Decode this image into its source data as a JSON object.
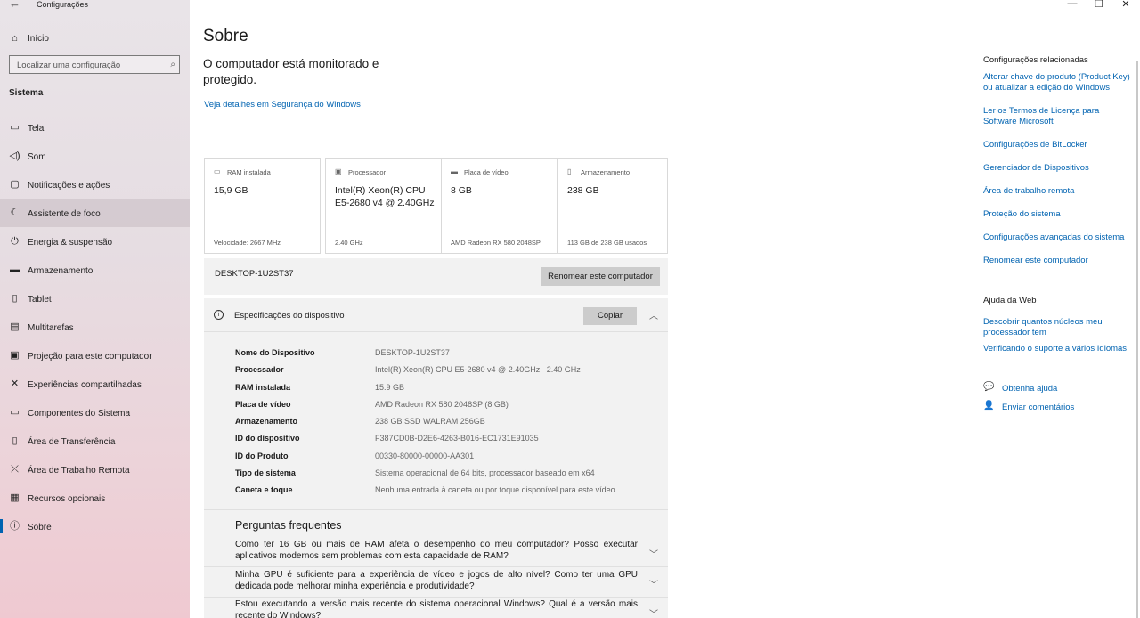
{
  "window": {
    "title": "Configurações",
    "minimize_icon": "—",
    "restore_icon": "❐",
    "close_icon": "✕"
  },
  "sidebar": {
    "home_label": "Início",
    "search_placeholder": "Localizar uma configuração",
    "section": "Sistema",
    "items": [
      {
        "label": "Tela",
        "icon": "monitor-icon"
      },
      {
        "label": "Som",
        "icon": "speaker-icon"
      },
      {
        "label": "Notificações e ações",
        "icon": "notification-icon"
      },
      {
        "label": "Assistente de foco",
        "icon": "moon-icon"
      },
      {
        "label": "Energia & suspensão",
        "icon": "power-icon"
      },
      {
        "label": "Armazenamento",
        "icon": "storage-icon"
      },
      {
        "label": "Tablet",
        "icon": "tablet-icon"
      },
      {
        "label": "Multitarefas",
        "icon": "multitask-icon"
      },
      {
        "label": "Projeção para este computador",
        "icon": "projection-icon"
      },
      {
        "label": "Experiências compartilhadas",
        "icon": "shared-icon"
      },
      {
        "label": "Componentes do Sistema",
        "icon": "components-icon"
      },
      {
        "label": "Área de Transferência",
        "icon": "clipboard-icon"
      },
      {
        "label": "Área de Trabalho Remota",
        "icon": "remote-icon"
      },
      {
        "label": "Recursos opcionais",
        "icon": "features-icon"
      },
      {
        "label": "Sobre",
        "icon": "info-icon"
      }
    ]
  },
  "main": {
    "title": "Sobre",
    "protection_text": "O computador está monitorado e protegido.",
    "security_link": "Veja detalhes em Segurança do Windows",
    "cards": [
      {
        "title": "RAM instalada",
        "value": "15,9 GB",
        "sub": "Velocidade: 2667 MHz"
      },
      {
        "title": "Processador",
        "value": "Intel(R) Xeon(R) CPU E5-2680 v4 @ 2.40GHz",
        "sub": "2.40 GHz"
      },
      {
        "title": "Placa de vídeo",
        "value": "8 GB",
        "sub": "AMD Radeon RX 580 2048SP"
      },
      {
        "title": "Armazenamento",
        "value": "238 GB",
        "sub": "113 GB de 238 GB usados"
      }
    ],
    "device_name": "DESKTOP-1U2ST37",
    "rename_button": "Renomear este computador",
    "specs_title": "Especificações do dispositivo",
    "copy_button": "Copiar",
    "specs": [
      {
        "label": "Nome do Dispositivo",
        "value": "DESKTOP-1U2ST37"
      },
      {
        "label": "Processador",
        "value": "Intel(R) Xeon(R) CPU E5-2680 v4 @ 2.40GHz   2.40 GHz"
      },
      {
        "label": "RAM instalada",
        "value": "15.9 GB"
      },
      {
        "label": "Placa de vídeo",
        "value": "AMD Radeon RX 580 2048SP (8 GB)"
      },
      {
        "label": "Armazenamento",
        "value": "238 GB SSD WALRAM 256GB"
      },
      {
        "label": "ID do dispositivo",
        "value": "F387CD0B-D2E6-4263-B016-EC1731E91035"
      },
      {
        "label": "ID do Produto",
        "value": "00330-80000-00000-AA301"
      },
      {
        "label": "Tipo de sistema",
        "value": "Sistema operacional de 64 bits, processador baseado em x64"
      },
      {
        "label": "Caneta e toque",
        "value": "Nenhuma entrada à caneta ou por toque disponível para este vídeo"
      }
    ],
    "faq_title": "Perguntas frequentes",
    "faq": [
      "Como ter 16 GB ou mais de RAM afeta o desempenho do meu computador? Posso executar aplicativos modernos sem problemas com esta capacidade de RAM?",
      "Minha GPU é suficiente para a experiência de vídeo e jogos de alto nível? Como ter uma GPU dedicada pode melhorar minha experiência e produtividade?",
      "Estou executando a versão mais recente do sistema operacional Windows? Qual é a versão mais recente do Windows?"
    ]
  },
  "related": {
    "title": "Configurações relacionadas",
    "links": [
      "Alterar chave do produto (Product Key) ou atualizar a edição do Windows",
      "Ler os Termos de Licença para Software Microsoft",
      "Configurações de BitLocker",
      "Gerenciador de Dispositivos",
      "Área de trabalho remota",
      "Proteção do sistema",
      "Configurações avançadas do sistema",
      "Renomear este computador"
    ]
  },
  "web_help": {
    "title": "Ajuda da Web",
    "links": [
      "Descobrir quantos núcleos meu processador tem",
      "Verificando o suporte a vários Idiomas"
    ]
  },
  "support": {
    "get_help": "Obtenha ajuda",
    "feedback": "Enviar comentários"
  },
  "colors": {
    "accent": "#0063b1",
    "sidebar_top": "#e9e4e8",
    "sidebar_bottom": "#efc9d1",
    "panel": "#f2f2f2",
    "button": "#cccccc"
  }
}
